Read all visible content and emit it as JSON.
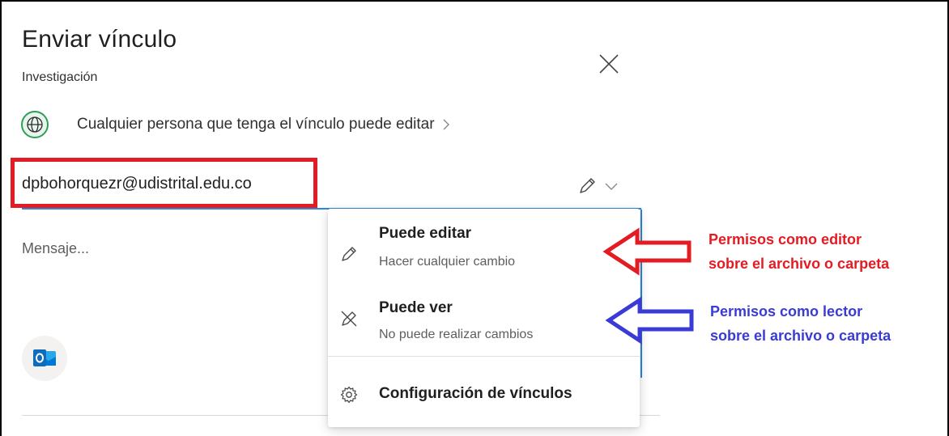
{
  "dialog": {
    "title": "Enviar vínculo",
    "subtitle": "Investigación",
    "access_text": "Cualquier persona que tenga el vínculo puede editar",
    "email_value": "dpbohorquezr@udistrital.edu.co",
    "message_placeholder": "Mensaje..."
  },
  "menu": {
    "items": [
      {
        "title": "Puede editar",
        "subtitle": "Hacer cualquier cambio",
        "icon": "pencil-icon"
      },
      {
        "title": "Puede ver",
        "subtitle": "No puede realizar cambios",
        "icon": "pencil-off-icon"
      }
    ],
    "settings_label": "Configuración de vínculos",
    "settings_icon": "gear-icon"
  },
  "annotations": {
    "editor_line1": "Permisos como editor",
    "editor_line2": "sobre el archivo o carpeta",
    "reader_line1": "Permisos como lector",
    "reader_line2": "sobre el archivo o carpeta"
  },
  "colors": {
    "highlight_red": "#e31b23",
    "highlight_blue": "#3a3bd6",
    "accent_blue": "#2b88d8",
    "globe_green": "#2f9e56",
    "outlook_blue": "#0f6cbd"
  }
}
